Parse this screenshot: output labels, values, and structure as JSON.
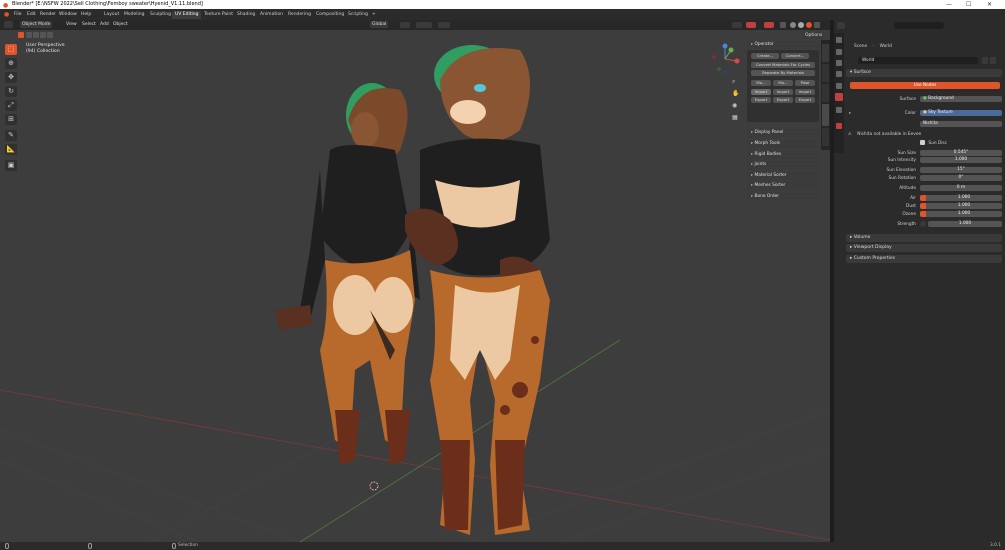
{
  "window": {
    "title": "Blender* [E:\\NSFW 2022\\Sell Clothing\\Femboy sweater\\Hyenid_V1.11.blend]",
    "controls": [
      "—",
      "☐",
      "✕"
    ]
  },
  "menu": {
    "items": [
      "File",
      "Edit",
      "Render",
      "Window",
      "Help"
    ],
    "workspaces": [
      "Layout",
      "Modeling",
      "Sculpting",
      "UV Editing",
      "Texture Paint",
      "Shading",
      "Animation",
      "Rendering",
      "Compositing",
      "Scripting"
    ],
    "active_workspace": "UV Editing",
    "add_tab": "+",
    "scene_label": "Scene",
    "view_layer_label": "View Layer"
  },
  "viewport_header": {
    "mode": "Object Mode",
    "menus": [
      "View",
      "Select",
      "Add",
      "Object"
    ],
    "transform": "Global",
    "options": "Options"
  },
  "viewport_overlay": {
    "perspective": "User Perspective",
    "collection": "(94) Collection"
  },
  "tools": [
    "select-box-tool",
    "cursor-tool",
    "move-tool",
    "rotate-tool",
    "scale-tool",
    "transform-tool",
    "annotate-tool",
    "measure-tool",
    "add-cube-tool"
  ],
  "n_panel": {
    "sections": [
      "Operator",
      "Display Panel",
      "Morph Tools",
      "Rigid Bodies",
      "Joints",
      "Material Sorter",
      "Meshes Sorter",
      "Bone Order"
    ],
    "create_label": "Create...",
    "convert_label": "Convert...",
    "convert_materials_label": "Convert Materials For Cycles",
    "separate_label": "Separate By Materials",
    "small_buttons": [
      "Mo...",
      "Mo...",
      "Pose"
    ],
    "import_export": [
      "Import",
      "Import",
      "Import",
      "Export",
      "Export",
      "Export"
    ],
    "side_tabs": [
      "Item",
      "Tool",
      "View",
      "MMD",
      "Misc"
    ]
  },
  "properties": {
    "breadcrumb": [
      "Scene",
      "World"
    ],
    "world_name": "World",
    "surface_header": "Surface",
    "use_nodes": "Use Nodes",
    "surface_label": "Surface",
    "surface_value": "Background",
    "color_label": "Color",
    "color_value": "Sky Texture",
    "sky_type": "Nishita",
    "warning": "Nishita not available in Eevee",
    "sun_disc": "Sun Disc",
    "fields": [
      {
        "label": "Sun Size",
        "value": "0.545°"
      },
      {
        "label": "Sun Intensity",
        "value": "1.000"
      },
      {
        "label": "Sun Elevation",
        "value": "15°"
      },
      {
        "label": "Sun Rotation",
        "value": "0°"
      },
      {
        "label": "Altitude",
        "value": "0 m"
      },
      {
        "label": "Air",
        "value": "1.000"
      },
      {
        "label": "Dust",
        "value": "1.000"
      },
      {
        "label": "Ozone",
        "value": "1.000"
      },
      {
        "label": "Strength",
        "value": "1.000"
      }
    ],
    "collapsed_sections": [
      "Volume",
      "Viewport Display",
      "Custom Properties"
    ]
  },
  "status": {
    "select_label": "Select",
    "zoom": "Selection",
    "version": "3.0.1"
  },
  "colors": {
    "accent": "#e0542a",
    "header_bg": "#282828",
    "viewport_bg": "#3d3d3d",
    "panel_bg": "#2b2b2b"
  }
}
